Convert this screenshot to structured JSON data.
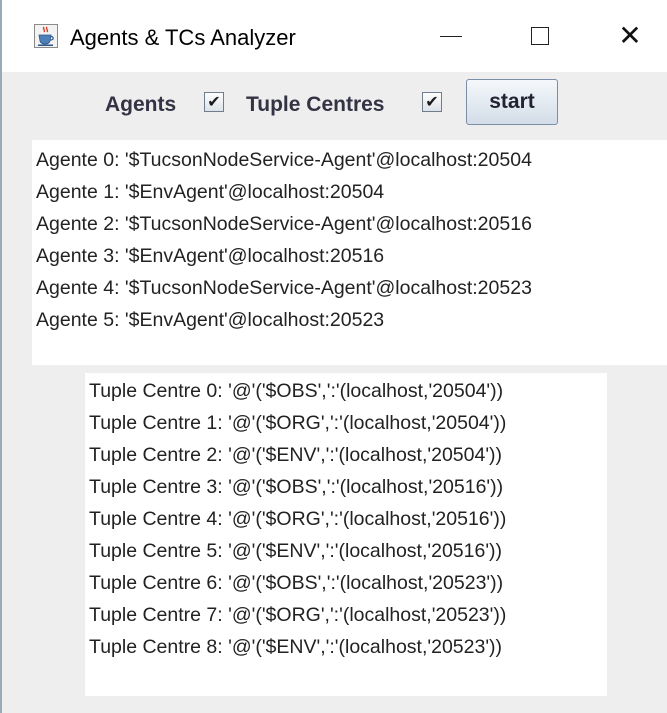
{
  "window": {
    "title": "Agents & TCs Analyzer",
    "icon": "java-cup-icon",
    "controls": {
      "minimize_icon": "minimize-icon",
      "maximize_icon": "maximize-icon",
      "close_icon": "close-icon"
    }
  },
  "toolbar": {
    "agents_label": "Agents",
    "agents_checked": true,
    "agents_check_glyph": "✔",
    "tc_label": "Tuple Centres",
    "tc_checked": true,
    "tc_check_glyph": "✔",
    "start_label": "start"
  },
  "agents": [
    "Agente 0: '$TucsonNodeService-Agent'@localhost:20504",
    "Agente 1: '$EnvAgent'@localhost:20504",
    "Agente 2: '$TucsonNodeService-Agent'@localhost:20516",
    "Agente 3: '$EnvAgent'@localhost:20516",
    "Agente 4: '$TucsonNodeService-Agent'@localhost:20523",
    "Agente 5: '$EnvAgent'@localhost:20523"
  ],
  "tuple_centres": [
    "Tuple Centre 0: '@'('$OBS',':'(localhost,'20504'))",
    "Tuple Centre 1: '@'('$ORG',':'(localhost,'20504'))",
    "Tuple Centre 2: '@'('$ENV',':'(localhost,'20504'))",
    "Tuple Centre 3: '@'('$OBS',':'(localhost,'20516'))",
    "Tuple Centre 4: '@'('$ORG',':'(localhost,'20516'))",
    "Tuple Centre 5: '@'('$ENV',':'(localhost,'20516'))",
    "Tuple Centre 6: '@'('$OBS',':'(localhost,'20523'))",
    "Tuple Centre 7: '@'('$ORG',':'(localhost,'20523'))",
    "Tuple Centre 8: '@'('$ENV',':'(localhost,'20523'))"
  ],
  "colors": {
    "window_bg": "#eeeeee",
    "panel_bg": "#ffffff",
    "text": "#222222"
  }
}
